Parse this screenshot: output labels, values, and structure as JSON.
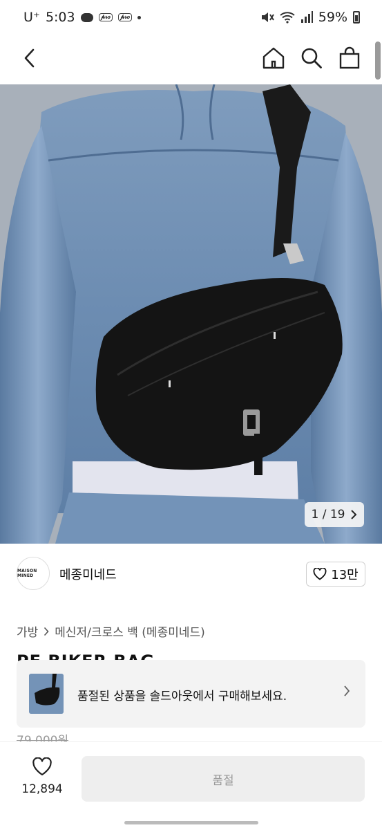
{
  "status_bar": {
    "carrier": "U⁺",
    "time": "5:03",
    "badge_1": "𝓅𝓇𝑜",
    "badge_2": "𝓅𝓇𝑜",
    "battery": "59%"
  },
  "nav": {
    "icons": [
      "back-icon",
      "home-icon",
      "search-icon",
      "shopping-bag-icon"
    ]
  },
  "gallery": {
    "pager": "1 / 19"
  },
  "brand": {
    "logo_text": "MAISON MINED",
    "name": "메종미네드",
    "likes": "13만"
  },
  "breadcrumb": [
    "가방",
    "메신저/크로스 백 (메종미네드)"
  ],
  "product": {
    "title": "PE BIKER BAG",
    "original_price": "79,000원"
  },
  "soldout_banner": {
    "text": "품절된 상품을 솔드아웃에서 구매해보세요."
  },
  "bottom": {
    "wish_count": "12,894",
    "buy_label": "품절"
  },
  "colors": {
    "denim": "#6f8fb3",
    "bag": "#141414",
    "disabled_button": "#eeeeee"
  }
}
